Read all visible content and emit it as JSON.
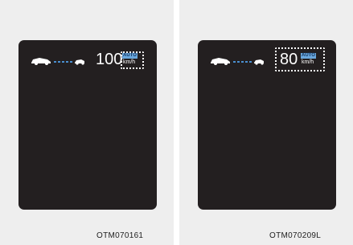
{
  "panels": [
    {
      "speed": "100",
      "auto_badge": "AUTO",
      "unit": "km/h",
      "caption": "OTM070161"
    },
    {
      "speed": "80",
      "auto_badge": "AUTO",
      "unit": "km/h",
      "caption": "OTM070209L"
    }
  ],
  "colors": {
    "screen": "#231f20",
    "auto_badge": "#6aa7dc",
    "distance_dots": "#4a8fd0"
  },
  "icons": {
    "vehicle_distance": "lead-car-distance-icon"
  }
}
